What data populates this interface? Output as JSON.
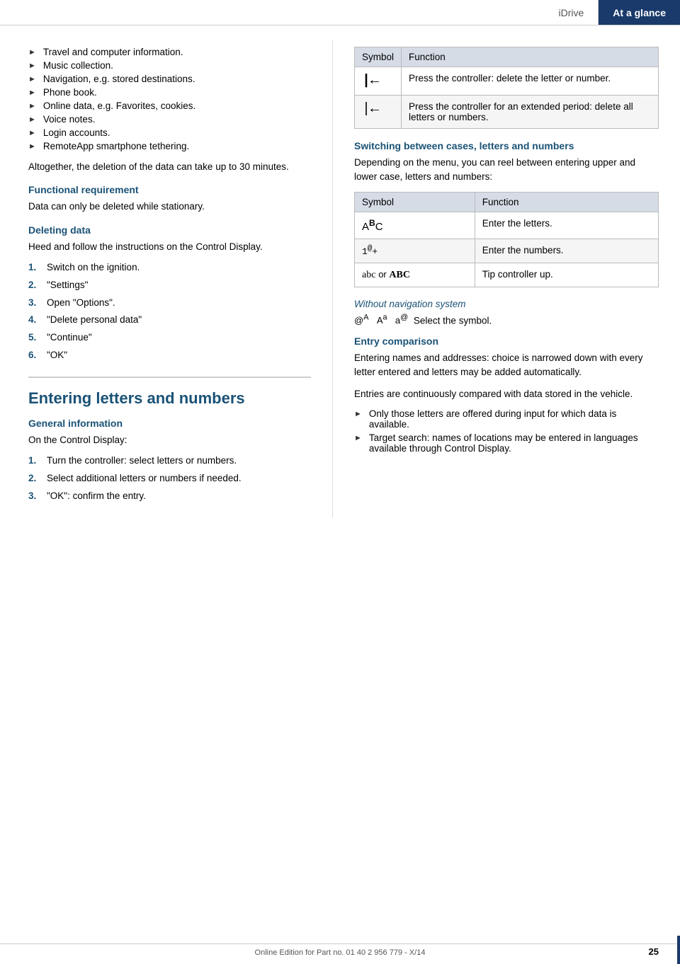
{
  "header": {
    "idrive_label": "iDrive",
    "at_a_glance_label": "At a glance"
  },
  "left_col": {
    "bullet_items": [
      "Travel and computer information.",
      "Music collection.",
      "Navigation, e.g. stored destinations.",
      "Phone book.",
      "Online data, e.g. Favorites, cookies.",
      "Voice notes.",
      "Login accounts.",
      "RemoteApp smartphone tethering."
    ],
    "deletion_note": "Altogether, the deletion of the data can take up to 30 minutes.",
    "functional_requirement_heading": "Functional requirement",
    "functional_requirement_text": "Data can only be deleted while stationary.",
    "deleting_data_heading": "Deleting data",
    "deleting_data_text": "Heed and follow the instructions on the Control Display.",
    "deleting_steps": [
      {
        "num": "1.",
        "text": "Switch on the ignition."
      },
      {
        "num": "2.",
        "text": "\"Settings\""
      },
      {
        "num": "3.",
        "text": "Open \"Options\"."
      },
      {
        "num": "4.",
        "text": "\"Delete personal data\""
      },
      {
        "num": "5.",
        "text": "\"Continue\""
      },
      {
        "num": "6.",
        "text": "\"OK\""
      }
    ],
    "big_heading": "Entering letters and numbers",
    "general_info_heading": "General information",
    "general_info_text": "On the Control Display:",
    "general_info_steps": [
      {
        "num": "1.",
        "text": "Turn the controller: select letters or numbers."
      },
      {
        "num": "2.",
        "text": "Select additional letters or numbers if needed."
      },
      {
        "num": "3.",
        "text": "\"OK\": confirm the entry."
      }
    ]
  },
  "right_col": {
    "table1_headers": [
      "Symbol",
      "Function"
    ],
    "table1_rows": [
      {
        "symbol": "delete1",
        "function": "Press the controller: delete the letter or number."
      },
      {
        "symbol": "delete2",
        "function": "Press the controller for an extended period: delete all letters or numbers."
      }
    ],
    "switching_heading": "Switching between cases, letters and numbers",
    "switching_intro": "Depending on the menu, you can reel between entering upper and lower case, letters and numbers:",
    "table2_headers": [
      "Symbol",
      "Function"
    ],
    "table2_rows": [
      {
        "symbol": "abc_upper",
        "function": "Enter the letters."
      },
      {
        "symbol": "num_sym",
        "function": "Enter the numbers."
      },
      {
        "symbol": "abc_tip",
        "function": "Tip controller up."
      }
    ],
    "without_nav_heading": "Without navigation system",
    "without_nav_text": "Select the symbol.",
    "entry_comparison_heading": "Entry comparison",
    "entry_comparison_p1": "Entering names and addresses: choice is narrowed down with every letter entered and letters may be added automatically.",
    "entry_comparison_p2": "Entries are continuously compared with data stored in the vehicle.",
    "entry_comparison_bullets": [
      "Only those letters are offered during input for which data is available.",
      "Target search: names of locations may be entered in languages available through Control Display."
    ]
  },
  "footer": {
    "text": "Online Edition for Part no. 01 40 2 956 779 - X/14",
    "page_number": "25"
  }
}
